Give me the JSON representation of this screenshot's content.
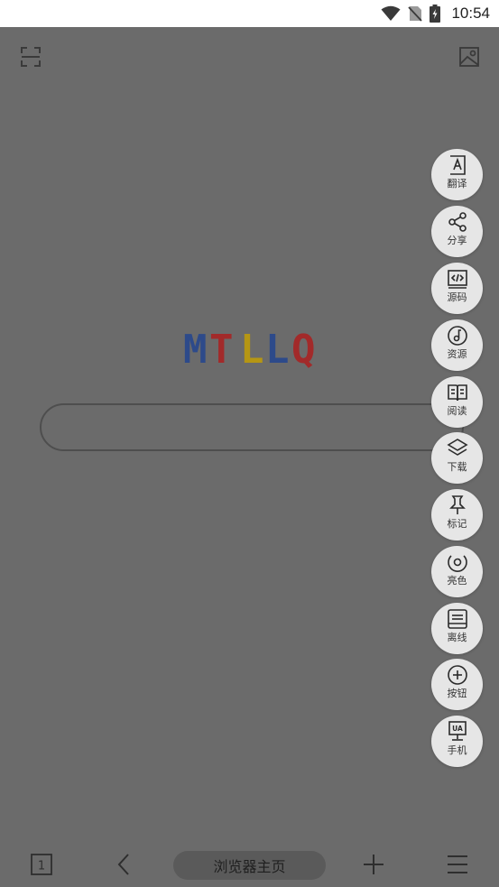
{
  "status_bar": {
    "time": "10:54"
  },
  "logo": {
    "letters": [
      "M",
      "T",
      "L",
      "L",
      "Q"
    ],
    "colors": [
      "#2d4a8a",
      "#a22a2a",
      "#b59614",
      "#2d4a8a",
      "#a22a2a"
    ]
  },
  "search": {
    "placeholder": ""
  },
  "actions": [
    {
      "name": "translate",
      "label": "翻译",
      "icon": "translate-icon"
    },
    {
      "name": "share",
      "label": "分享",
      "icon": "share-icon"
    },
    {
      "name": "source",
      "label": "源码",
      "icon": "code-icon"
    },
    {
      "name": "resources",
      "label": "资源",
      "icon": "music-note-icon"
    },
    {
      "name": "reading",
      "label": "阅读",
      "icon": "book-icon"
    },
    {
      "name": "download",
      "label": "下载",
      "icon": "layers-icon"
    },
    {
      "name": "bookmark",
      "label": "标记",
      "icon": "pin-icon"
    },
    {
      "name": "brightness",
      "label": "亮色",
      "icon": "eye-icon"
    },
    {
      "name": "offline",
      "label": "离线",
      "icon": "offline-page-icon"
    },
    {
      "name": "buttons",
      "label": "按钮",
      "icon": "plus-circle-icon"
    },
    {
      "name": "mobile",
      "label": "手机",
      "icon": "ua-monitor-icon"
    }
  ],
  "bottom_bar": {
    "tab_count": "1",
    "home_label": "浏览器主页"
  },
  "colors": {
    "dim_background": "#6b6b6b",
    "fab_background": "#e6e6e6"
  }
}
